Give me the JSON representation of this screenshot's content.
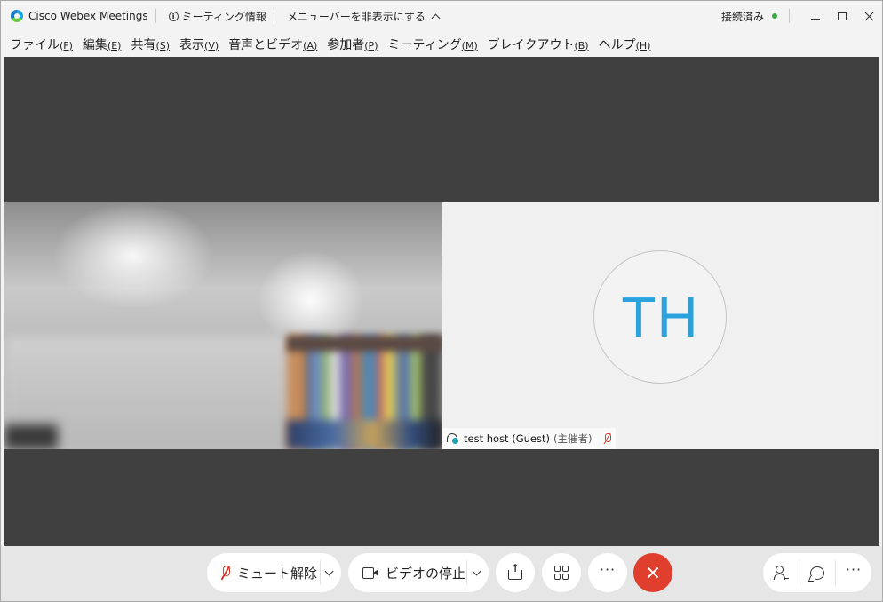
{
  "titlebar": {
    "app_title": "Cisco Webex Meetings",
    "meeting_info_label": "ミーティング情報",
    "hide_menu_label": "メニューバーを非表示にする",
    "status_label": "接続済み",
    "status_color": "#3aa845"
  },
  "menubar": {
    "items": [
      {
        "label": "ファイル",
        "accel": "(F)"
      },
      {
        "label": "編集",
        "accel": "(E)"
      },
      {
        "label": "共有",
        "accel": "(S)"
      },
      {
        "label": "表示",
        "accel": "(V)"
      },
      {
        "label": "音声とビデオ",
        "accel": "(A)"
      },
      {
        "label": "参加者",
        "accel": "(P)"
      },
      {
        "label": "ミーティング",
        "accel": "(M)"
      },
      {
        "label": "ブレイクアウト",
        "accel": "(B)"
      },
      {
        "label": "ヘルプ",
        "accel": "(H)"
      }
    ]
  },
  "participants": {
    "remote": {
      "initials": "TH",
      "name": "test host (Guest)",
      "role": "(主催者)",
      "avatar_color": "#2aa3dd"
    }
  },
  "controls": {
    "mute_label": "ミュート解除",
    "video_label": "ビデオの停止",
    "more_glyph": "···",
    "leave_color": "#df3f2c",
    "right_more_glyph": "···"
  },
  "icons": {
    "app": "webex-logo-icon",
    "info": "info-icon",
    "mic_muted": "mic-muted-icon",
    "camera": "camera-icon",
    "share": "share-icon",
    "apps": "apps-icon",
    "leave": "close-icon",
    "participants": "participants-icon",
    "chat": "chat-icon"
  }
}
